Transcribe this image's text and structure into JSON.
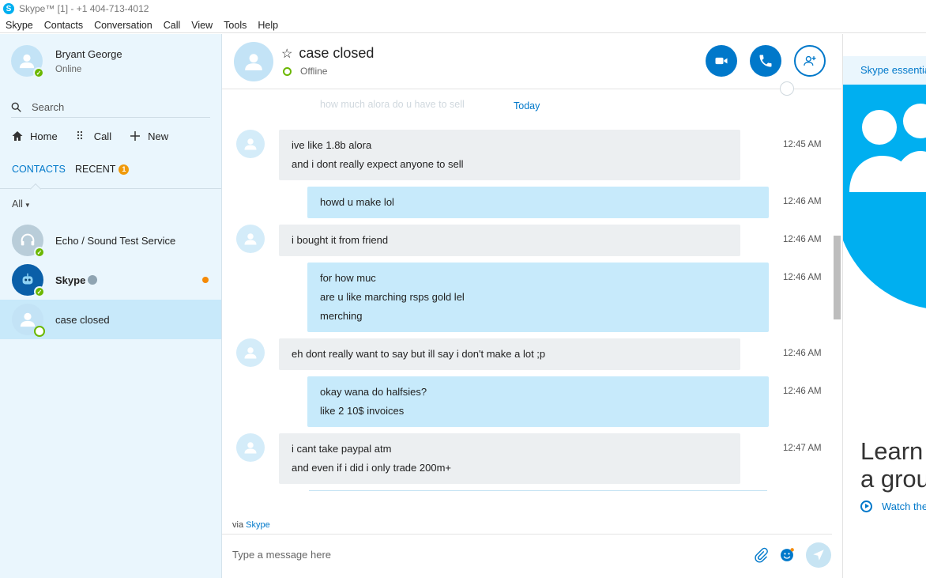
{
  "window": {
    "title": "Skype™ [1] - +1 404-713-4012",
    "app_icon": "S"
  },
  "menu": [
    "Skype",
    "Contacts",
    "Conversation",
    "Call",
    "View",
    "Tools",
    "Help"
  ],
  "profile": {
    "name": "Bryant George",
    "status": "Online"
  },
  "search": {
    "placeholder": "Search"
  },
  "nav": {
    "home": "Home",
    "call": "Call",
    "new": "New"
  },
  "tabs": {
    "contacts": "CONTACTS",
    "recent": "RECENT",
    "recent_badge": "1"
  },
  "filter": {
    "label": "All"
  },
  "contacts": [
    {
      "name": "Echo / Sound Test Service"
    },
    {
      "name": "Skype"
    },
    {
      "name": "case closed"
    }
  ],
  "chat": {
    "title": "case closed",
    "status": "Offline",
    "faded_preview": "how much alora do u have to sell",
    "date_label": "Today",
    "messages": [
      {
        "dir": "in",
        "lines": [
          "ive like 1.8b alora",
          "and i dont really expect anyone to sell"
        ],
        "time": "12:45 AM"
      },
      {
        "dir": "out",
        "lines": [
          "howd u make lol"
        ],
        "time": "12:46 AM"
      },
      {
        "dir": "in",
        "lines": [
          "i bought it from friend"
        ],
        "time": "12:46 AM"
      },
      {
        "dir": "out",
        "lines": [
          "for how muc",
          "are u like marching rsps gold lel",
          "merching"
        ],
        "time": "12:46 AM"
      },
      {
        "dir": "in",
        "lines": [
          "eh dont really want to say but ill say i don't make a lot ;p"
        ],
        "time": "12:46 AM"
      },
      {
        "dir": "out",
        "lines": [
          "okay wana do halfsies?",
          "like 2 10$ invoices"
        ],
        "time": "12:46 AM"
      },
      {
        "dir": "in",
        "lines": [
          "i cant take paypal atm",
          "and even if i did i only trade 200m+"
        ],
        "time": "12:47 AM"
      }
    ],
    "via_prefix": "via",
    "via_link": "Skype",
    "compose_placeholder": "Type a message here"
  },
  "right_panel": {
    "essentials": "Skype essentia",
    "learn_line1": "Learn",
    "learn_line2": "a grou",
    "watch": "Watch the"
  },
  "colors": {
    "accent": "#0078ca",
    "skype_blue": "#00aff0",
    "online": "#6bb700",
    "badge": "#f09a0b"
  }
}
